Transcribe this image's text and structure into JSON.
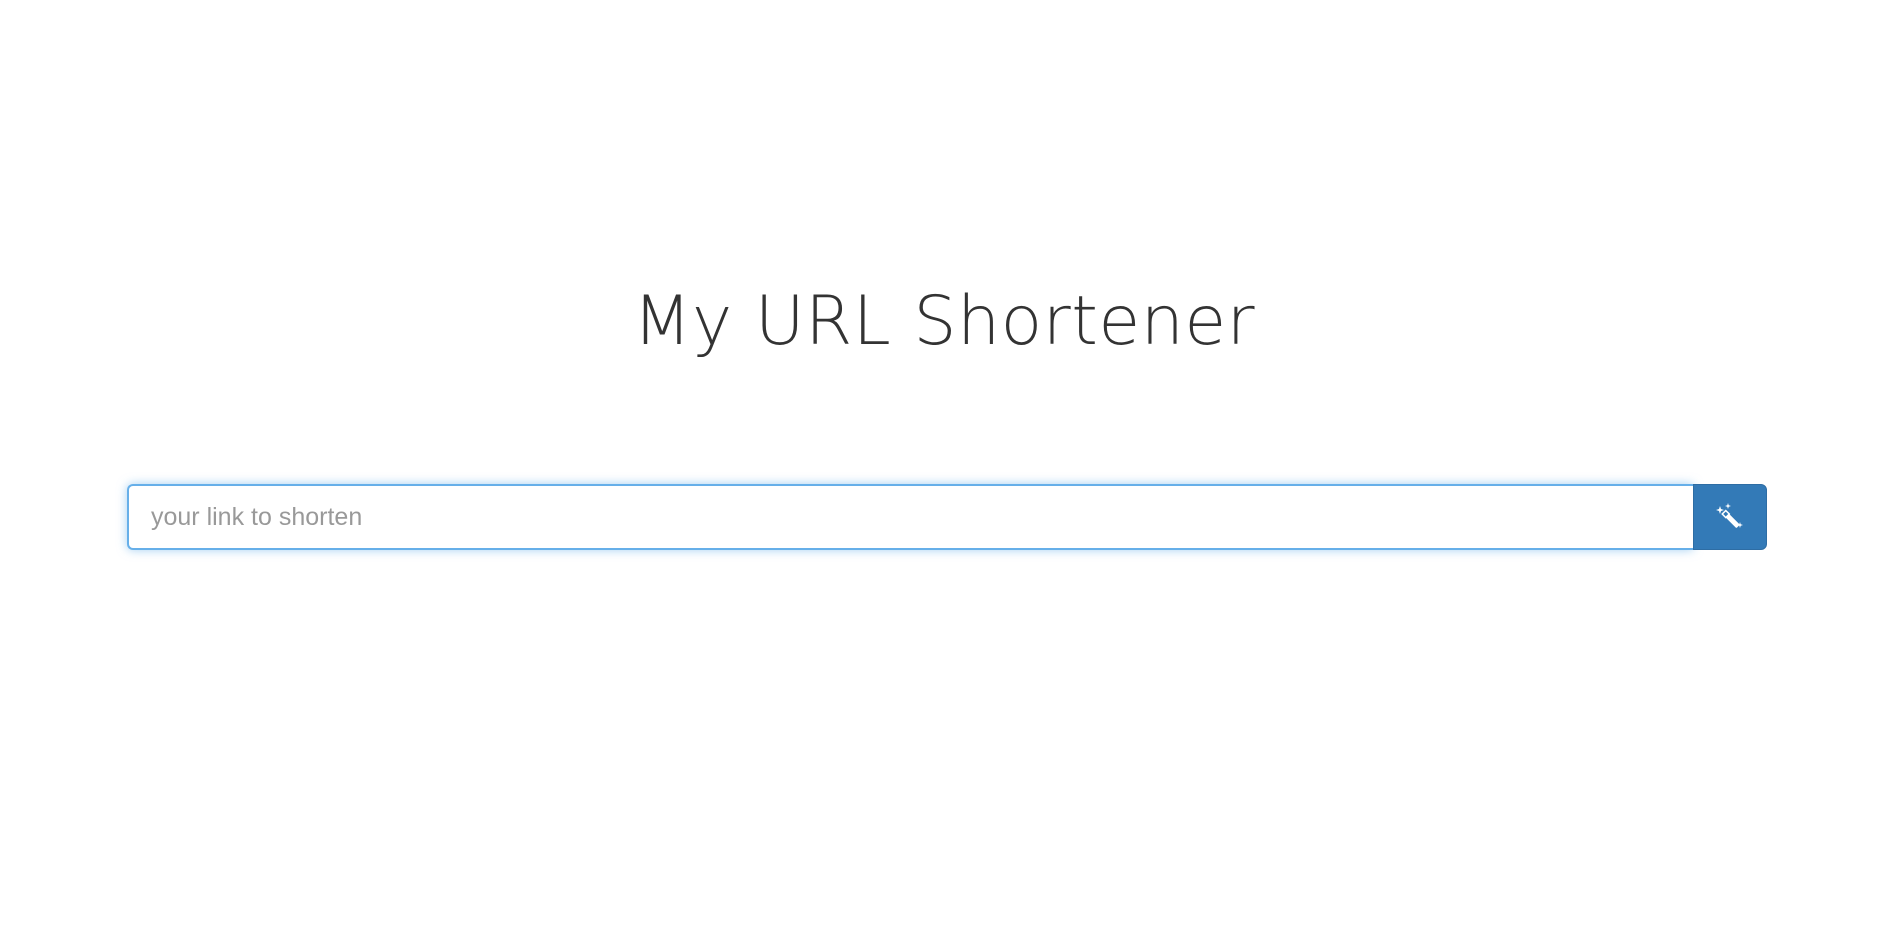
{
  "page": {
    "title": "My URL Shortener"
  },
  "form": {
    "input_placeholder": "your link to shorten",
    "input_value": "",
    "button_icon": "magic-wand-icon"
  },
  "colors": {
    "title_text": "#333333",
    "button_bg": "#337ab7",
    "input_focus_border": "#66afe9",
    "placeholder": "#999999",
    "background": "#ffffff"
  }
}
